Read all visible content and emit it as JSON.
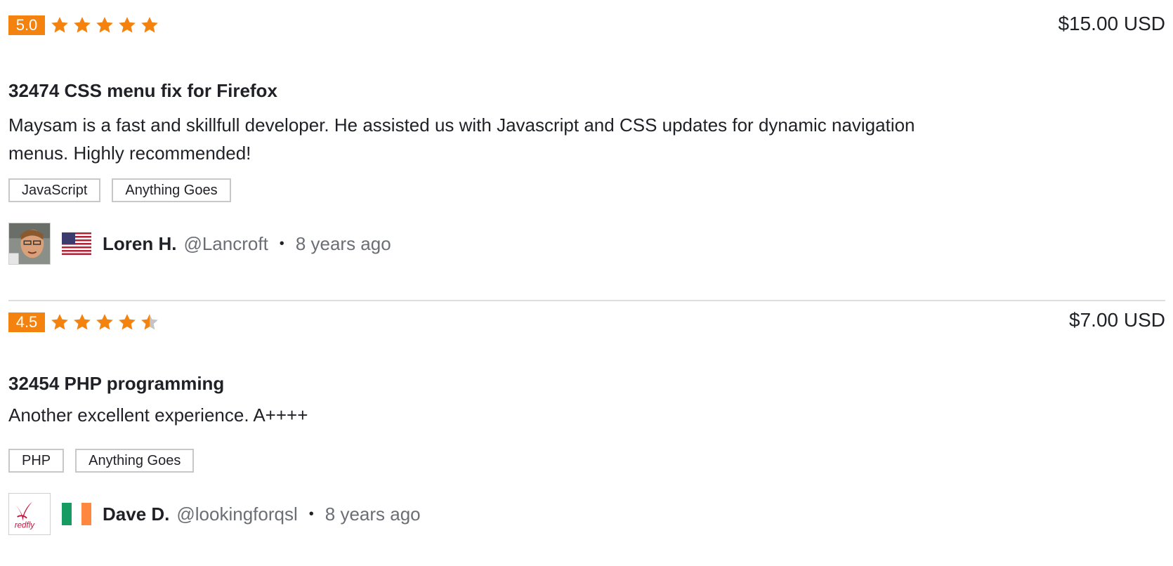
{
  "colors": {
    "accent_orange": "#f4820e",
    "star_gray": "#c4c4c4",
    "text_dark": "#1f2126",
    "text_muted": "#6b6f75",
    "tag_border": "#c8c8c8"
  },
  "reviews": [
    {
      "score": "5.0",
      "rating": 5.0,
      "price": "$15.00 USD",
      "title": "32474 CSS menu fix for Firefox",
      "description": "Maysam is a fast and skillfull developer. He assisted us with Javascript and CSS updates for dynamic navigation menus. Highly recommended!",
      "tags": [
        "JavaScript",
        "Anything Goes"
      ],
      "author": {
        "name": "Loren H.",
        "handle": "@Lancroft",
        "separator": "•",
        "time_ago": "8 years ago",
        "avatar_icon": "person-photo-avatar",
        "flag_icon": "us-flag-icon"
      }
    },
    {
      "score": "4.5",
      "rating": 4.5,
      "price": "$7.00 USD",
      "title": "32454 PHP programming",
      "description": "Another excellent experience. A++++",
      "tags": [
        "PHP",
        "Anything Goes"
      ],
      "author": {
        "name": "Dave D.",
        "handle": "@lookingforqsl",
        "separator": "•",
        "time_ago": "8 years ago",
        "avatar_icon": "redfly-logo-avatar",
        "flag_icon": "ireland-flag-icon",
        "avatar_logo_text": "redfly"
      }
    }
  ]
}
